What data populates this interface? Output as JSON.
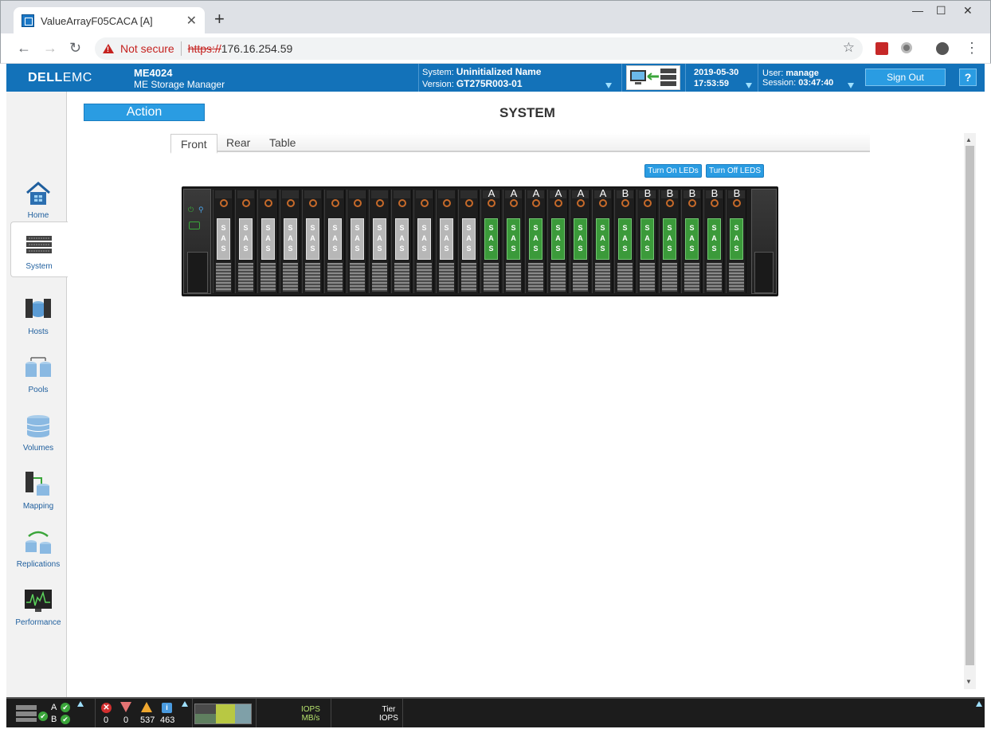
{
  "browser": {
    "tab_title": "ValueArrayF05CACA [A]",
    "security_label": "Not secure",
    "url_scheme": "https://",
    "url_host": "176.16.254.59"
  },
  "header": {
    "logo_a": "D&#x2BC8;LL",
    "logo_text_bold": "DELL",
    "logo_text_light": "EMC",
    "product": "ME4024",
    "product_sub": "ME Storage Manager",
    "system_label": "System:",
    "system_name": "Uninitialized Name",
    "version_label": "Version:",
    "version": "GT275R003-01",
    "date": "2019-05-30",
    "time": "17:53:59",
    "user_label": "User:",
    "user": "manage",
    "session_label": "Session:",
    "session": "03:47:40",
    "sign_out": "Sign Out",
    "help": "?"
  },
  "sidebar": {
    "items": [
      {
        "label": "Home",
        "icon": "home-icon"
      },
      {
        "label": "System",
        "icon": "system-icon"
      },
      {
        "label": "Hosts",
        "icon": "hosts-icon"
      },
      {
        "label": "Pools",
        "icon": "pools-icon"
      },
      {
        "label": "Volumes",
        "icon": "volumes-icon"
      },
      {
        "label": "Mapping",
        "icon": "mapping-icon"
      },
      {
        "label": "Replications",
        "icon": "replications-icon"
      },
      {
        "label": "Performance",
        "icon": "performance-icon"
      }
    ],
    "active": "System"
  },
  "main": {
    "action": "Action",
    "title": "SYSTEM",
    "tabs": [
      {
        "label": "Front"
      },
      {
        "label": "Rear"
      },
      {
        "label": "Table"
      }
    ],
    "active_tab": "Front",
    "led_on": "Turn On LEDs",
    "led_off": "Turn Off LEDS",
    "enclosure": {
      "disk_label": "SAS",
      "bays": [
        {
          "owner": "",
          "state": "empty"
        },
        {
          "owner": "",
          "state": "empty"
        },
        {
          "owner": "",
          "state": "empty"
        },
        {
          "owner": "",
          "state": "empty"
        },
        {
          "owner": "",
          "state": "empty"
        },
        {
          "owner": "",
          "state": "empty"
        },
        {
          "owner": "",
          "state": "empty"
        },
        {
          "owner": "",
          "state": "empty"
        },
        {
          "owner": "",
          "state": "empty"
        },
        {
          "owner": "",
          "state": "empty"
        },
        {
          "owner": "",
          "state": "empty"
        },
        {
          "owner": "",
          "state": "empty"
        },
        {
          "owner": "A",
          "state": "used"
        },
        {
          "owner": "A",
          "state": "used"
        },
        {
          "owner": "A",
          "state": "used"
        },
        {
          "owner": "A",
          "state": "used"
        },
        {
          "owner": "A",
          "state": "used"
        },
        {
          "owner": "A",
          "state": "used"
        },
        {
          "owner": "B",
          "state": "used"
        },
        {
          "owner": "B",
          "state": "used"
        },
        {
          "owner": "B",
          "state": "used"
        },
        {
          "owner": "B",
          "state": "used"
        },
        {
          "owner": "B",
          "state": "used"
        },
        {
          "owner": "B",
          "state": "used"
        }
      ]
    }
  },
  "footer": {
    "controller_a": "A",
    "controller_b": "B",
    "critical_count": "0",
    "error_count": "0",
    "warning_count": "537",
    "info_count": "463",
    "perf_line1": "IOPS",
    "perf_line2": "MB/s",
    "tier_line1": "Tier",
    "tier_line2": "IOPS"
  },
  "colors": {
    "header_blue": "#1372b9",
    "button_blue": "#2a9ce2",
    "disk_used_green": "#3b9a3a",
    "warning_red": "#c5221f"
  }
}
